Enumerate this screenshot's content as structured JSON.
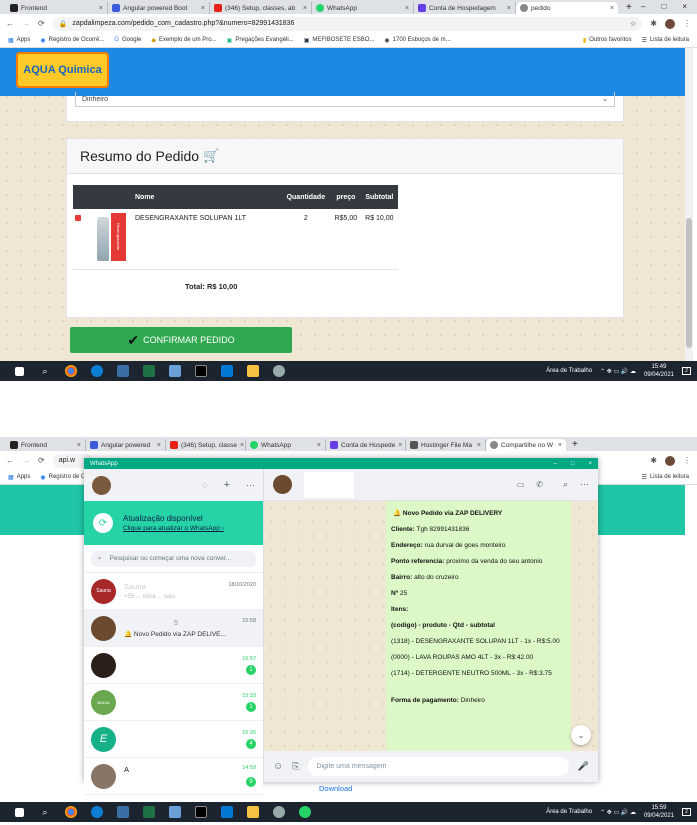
{
  "top": {
    "tabs": [
      "Frontend",
      "Angular powered Boot",
      "(346) Setup, classes, ab",
      "WhatsApp",
      "Conta de Hospedagem",
      "pedido"
    ],
    "url": "zapdalimpeza.com/pedido_com_cadastro.php?&numero=82991431836",
    "bookmarks": [
      "Apps",
      "Registro de Ocorrê...",
      "Google",
      "Exemplo de um Pro...",
      "Pregações Evangéli...",
      "MEFIBOSETE ESBO...",
      "1700 Esboços de m..."
    ],
    "bookmarks_right": [
      "Outros favoritos",
      "Lista de leitura"
    ],
    "logo": "AQUA Quimica",
    "payment_value": "Dinheiro",
    "summary_title": "Resumo do Pedido",
    "table_headers": [
      "Nome",
      "Quantidade",
      "preço",
      "Subtotal"
    ],
    "product": {
      "name": "DESENGRAXANTE SOLUPAN 1LT",
      "qty": "2",
      "price": "R$5,00",
      "subtotal": "R$ 10,00",
      "label": "Desengraxante",
      "size": "1L"
    },
    "total": "Total: R$ 10,00",
    "confirm": "CONFIRMAR PEDIDO",
    "clock_time": "15:49",
    "clock_date": "09/04/2021",
    "desktop": "Área de Trabalho"
  },
  "bottom": {
    "tabs": [
      "Frontend",
      "Angular powered",
      "(346) Setup, classe",
      "WhatsApp",
      "Conta de Hospede",
      "Hostinger File Ma",
      "Compartilhe no W"
    ],
    "url": "api.w",
    "bookmarks": [
      "Apps",
      "Registro de O"
    ],
    "bookmarks_right": [
      "Lista de leitura"
    ],
    "wa_title": "WhatsApp",
    "update_title": "Atualização disponível",
    "update_link": "Clique para atualizar o WhatsApp ›",
    "search_placeholder": "Pesquisar ou começar uma nova conver...",
    "chats": [
      {
        "name": "Sauna",
        "time": "18/10/2020",
        "preview": "+55 ... nova ... saiu",
        "badge": ""
      },
      {
        "name": "5",
        "time": "15:58",
        "preview": "🔔 Novo Pedido via  ZAP DELIVE...",
        "badge": ""
      },
      {
        "name": "",
        "time": "15:57",
        "preview": "",
        "badge": "1"
      },
      {
        "name": "",
        "time": "15:33",
        "preview": "",
        "badge": "1"
      },
      {
        "name": "",
        "time": "15:26",
        "preview": "",
        "badge": "4"
      },
      {
        "name": "A",
        "time": "14:59",
        "preview": "",
        "badge": "9"
      }
    ],
    "msg": {
      "title": "Novo Pedido via  ZAP DELIVERY",
      "lines": [
        {
          "k": "Cliente:",
          "v": " Tgh  82991431836"
        },
        {
          "k": "Endereço:",
          "v": " rua durval de goes monteiro"
        },
        {
          "k": "Ponto referencia:",
          "v": " proximo da venda do seu antonio"
        },
        {
          "k": "Bairro:",
          "v": " alto do cruzeiro"
        },
        {
          "k": "Nº",
          "v": " 25"
        },
        {
          "k": "Itens:",
          "v": ""
        },
        {
          "k": "(codigo) - produto - Qtd - subtotal",
          "v": ""
        },
        {
          "k": "",
          "v": " (1318) - DESENGRAXANTE SOLUPAN  1LT - 1x - R$:5.00"
        },
        {
          "k": "",
          "v": " (0000) - LAVA ROUPAS AMO 4LT - 3x - R$:42.00"
        },
        {
          "k": "",
          "v": " (1714) - DETERGENTE NEUTRO 500ML - 3x - R$:3.75"
        },
        {
          "k": "Forma de pagamento:",
          "v": " Dinheiro"
        }
      ]
    },
    "compose_placeholder": "Digite uma mensagem",
    "download": "Download",
    "clock_time": "15:59",
    "clock_date": "09/04/2021",
    "desktop": "Área de Trabalho"
  }
}
